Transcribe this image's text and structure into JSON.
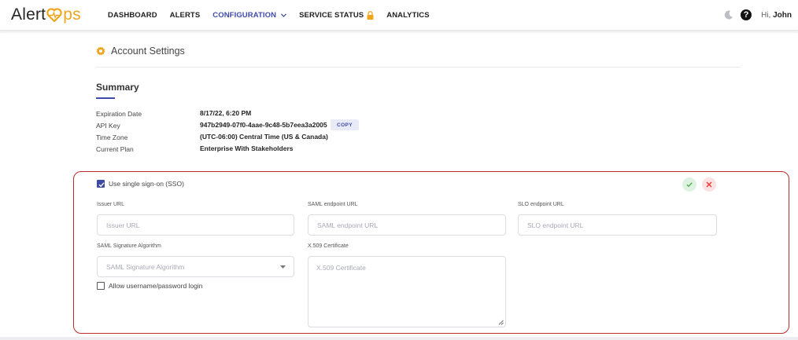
{
  "brand": {
    "logo_left": "Alert",
    "logo_right": "ps"
  },
  "nav": {
    "items": [
      {
        "label": "DASHBOARD"
      },
      {
        "label": "ALERTS"
      },
      {
        "label": "CONFIGURATION"
      },
      {
        "label": "SERVICE STATUS"
      },
      {
        "label": "ANALYTICS"
      }
    ]
  },
  "user": {
    "greeting": "Hi,",
    "name": "John"
  },
  "page": {
    "title": "Account Settings"
  },
  "summary": {
    "title": "Summary",
    "rows": [
      {
        "key": "Expiration Date",
        "value": "8/17/22, 6:20 PM"
      },
      {
        "key": "API Key",
        "value": "947b2949-07f0-4aae-9c48-5b7eea3a2005"
      },
      {
        "key": "Time Zone",
        "value": "(UTC-06:00) Central Time (US & Canada)"
      },
      {
        "key": "Current Plan",
        "value": "Enterprise With Stakeholders"
      }
    ],
    "copy_label": "COPY"
  },
  "sso": {
    "use_sso_label": "Use single sign-on (SSO)",
    "use_sso_checked": true,
    "issuer_url": {
      "label": "Issuer URL",
      "placeholder": "Issuer URL"
    },
    "saml_endpoint_url": {
      "label": "SAML endpoint URL",
      "placeholder": "SAML endpoint URL"
    },
    "slo_endpoint_url": {
      "label": "SLO endpoint URL",
      "placeholder": "SLO endpoint URL"
    },
    "saml_signature_algorithm": {
      "label": "SAML Signature Algorithm",
      "placeholder": "SAML Signature Algorithm"
    },
    "x509_certificate": {
      "label": "X.509 Certificate",
      "placeholder": "X.509 Certificate"
    },
    "allow_password_label": "Allow username/password login",
    "allow_password_checked": false
  },
  "colors": {
    "accent": "#3e4aa8",
    "brand_orange": "#f0a51d",
    "highlight_border": "#c02a2a",
    "confirm": "#4caf50",
    "cancel": "#e53935"
  },
  "icons": [
    "heart-logo-icon",
    "chevron-down-icon",
    "lock-icon",
    "moon-icon",
    "help-icon",
    "gear-icon",
    "checkmark-icon",
    "close-icon",
    "dropdown-caret-icon",
    "resize-grip-icon"
  ]
}
